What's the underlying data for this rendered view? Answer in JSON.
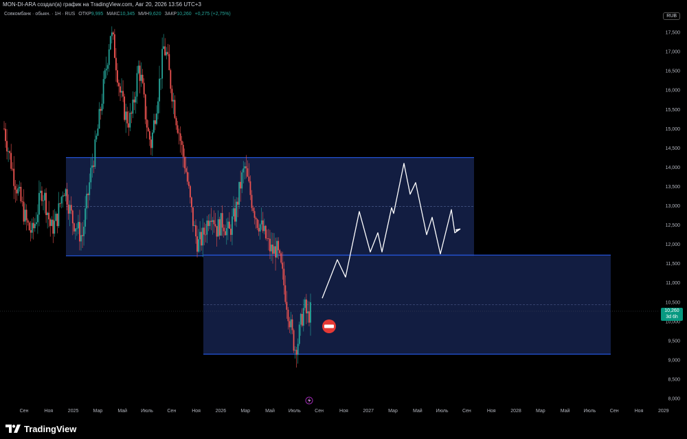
{
  "header": {
    "title": "MON-DI-ARA создал(а) график на TradingView.com, Авг 20, 2026 13:56 UTC+3"
  },
  "legend": {
    "symbol": "Совкомбанк · обыкн. · 1Н · RUS",
    "open_label": "ОТКР",
    "open": "9,995",
    "high_label": "МАКС",
    "high": "10,345",
    "low_label": "МИН",
    "low": "9,620",
    "close_label": "ЗАКР",
    "close": "10,260",
    "change": "+0,275 (+2,75%)"
  },
  "currency": "RUB",
  "price_tag": {
    "price": "10,260",
    "countdown": "3d 6h"
  },
  "footer": {
    "brand": "TradingView"
  },
  "colors": {
    "up": "#26a69a",
    "down": "#ef5350",
    "zone_fill": "#132046",
    "zone_line": "#2962ff",
    "path": "#ffffff",
    "tag": "#089981"
  },
  "chart_data": {
    "type": "candlestick",
    "title": "",
    "xlabel": "",
    "ylabel": "",
    "ylim": [
      7.95,
      18.0
    ],
    "y_ticks": [
      "8,000",
      "8,500",
      "9,000",
      "9,500",
      "10,000",
      "10,500",
      "11,000",
      "11,500",
      "12,000",
      "12,500",
      "13,000",
      "13,500",
      "14,000",
      "14,500",
      "15,000",
      "15,500",
      "16,000",
      "16,500",
      "17,000",
      "17,500"
    ],
    "x_ticks": [
      "Сен",
      "Ноя",
      "2025",
      "Мар",
      "Май",
      "Июль",
      "Сен",
      "Ноя",
      "2026",
      "Мар",
      "Май",
      "Июль",
      "Сен",
      "Ноя",
      "2027",
      "Мар",
      "Май",
      "Июль",
      "Сен",
      "Ноя",
      "2028",
      "Мар",
      "Май",
      "Июль",
      "Сен",
      "Ноя",
      "2029"
    ],
    "last_price": 10.26,
    "closes": [
      15.0,
      14.6,
      14.2,
      13.8,
      13.5,
      13.2,
      12.9,
      12.6,
      12.4,
      12.3,
      12.6,
      13.0,
      13.4,
      13.2,
      12.8,
      12.4,
      12.5,
      12.7,
      13.1,
      13.5,
      13.3,
      12.9,
      12.6,
      12.5,
      12.3,
      12.2,
      12.8,
      13.4,
      14.0,
      14.4,
      15.0,
      15.6,
      16.2,
      16.8,
      17.5,
      17.2,
      16.6,
      16.0,
      15.6,
      15.3,
      15.2,
      15.4,
      16.0,
      16.6,
      16.2,
      15.5,
      14.9,
      14.6,
      15.2,
      15.8,
      16.4,
      17.1,
      16.9,
      16.3,
      15.8,
      15.3,
      14.9,
      14.4,
      14.0,
      13.4,
      12.8,
      12.3,
      12.0,
      12.1,
      12.3,
      12.6,
      12.9,
      12.7,
      12.4,
      12.5,
      12.6,
      12.4,
      12.3,
      12.6,
      12.8,
      13.3,
      13.7,
      14.0,
      13.6,
      13.2,
      12.9,
      12.6,
      12.5,
      12.3,
      12.1,
      11.9,
      11.8,
      11.9,
      11.6,
      11.2,
      10.7,
      10.2,
      9.7,
      9.3,
      9.5,
      10.0,
      10.4,
      10.1,
      10.26
    ],
    "zones": [
      {
        "x_from": "2024-12",
        "x_to": "2027-08",
        "y_from": 11.7,
        "y_to": 14.25,
        "mid": 12.98
      },
      {
        "x_from": "2025-10",
        "x_to": "2028-10",
        "y_from": 9.15,
        "y_to": 11.72,
        "mid": 10.43
      }
    ],
    "projection": [
      [
        10.6,
        "2026-09"
      ],
      [
        11.6,
        "2026-10"
      ],
      [
        11.15,
        "2026-11"
      ],
      [
        12.85,
        "2027-01"
      ],
      [
        11.8,
        "2027-02"
      ],
      [
        12.3,
        "2027-03"
      ],
      [
        11.8,
        "2027-03"
      ],
      [
        12.95,
        "2027-04"
      ],
      [
        12.8,
        "2027-04"
      ],
      [
        14.1,
        "2027-05"
      ],
      [
        13.3,
        "2027-06"
      ],
      [
        13.6,
        "2027-06"
      ],
      [
        12.25,
        "2027-07"
      ],
      [
        12.7,
        "2027-08"
      ],
      [
        11.75,
        "2027-08"
      ],
      [
        12.9,
        "2027-09"
      ],
      [
        12.3,
        "2027-10"
      ],
      [
        12.4,
        "2027-10"
      ]
    ]
  }
}
